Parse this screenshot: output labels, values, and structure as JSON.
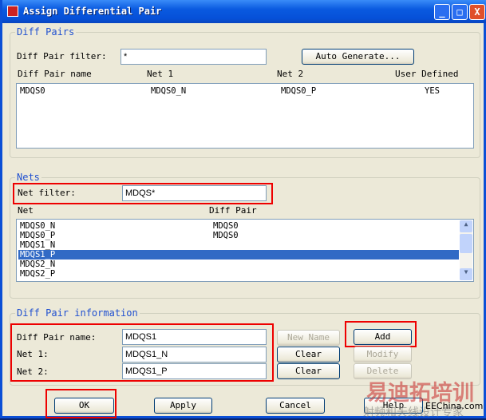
{
  "window": {
    "title": "Assign Differential Pair",
    "minimize": "_",
    "maximize": "□",
    "close": "X"
  },
  "diff_pairs": {
    "group_label": "Diff Pairs",
    "filter_label": "Diff Pair filter:",
    "filter_value": "*",
    "auto_generate": "Auto Generate...",
    "columns": [
      "Diff Pair name",
      "Net 1",
      "Net 2",
      "User Defined"
    ],
    "rows": [
      {
        "name": "MDQS0",
        "net1": "MDQS0_N",
        "net2": "MDQS0_P",
        "user_defined": "YES"
      }
    ]
  },
  "nets": {
    "group_label": "Nets",
    "filter_label": "Net filter:",
    "filter_value": "MDQS*",
    "columns": [
      "Net",
      "Diff Pair"
    ],
    "rows": [
      {
        "net": "MDQS0_N",
        "pair": "MDQS0"
      },
      {
        "net": "MDQS0_P",
        "pair": "MDQS0"
      },
      {
        "net": "MDQS1_N",
        "pair": ""
      },
      {
        "net": "MDQS1_P",
        "pair": "",
        "selected": true
      },
      {
        "net": "MDQS2_N",
        "pair": ""
      },
      {
        "net": "MDQS2_P",
        "pair": ""
      }
    ]
  },
  "info": {
    "group_label": "Diff Pair information",
    "name_label": "Diff Pair name:",
    "name_value": "MDQS1",
    "net1_label": "Net 1:",
    "net1_value": "MDQS1_N",
    "net2_label": "Net 2:",
    "net2_value": "MDQS1_P",
    "new_name": "New Name",
    "clear1": "Clear",
    "clear2": "Clear",
    "add": "Add",
    "modify": "Modify",
    "delete": "Delete"
  },
  "footer": {
    "ok": "OK",
    "apply": "Apply",
    "cancel": "Cancel",
    "help": "Help"
  },
  "watermark": {
    "brand": "易迪拓培训",
    "slogan": "射频和天线设计专家",
    "site": "EEChina.com"
  }
}
